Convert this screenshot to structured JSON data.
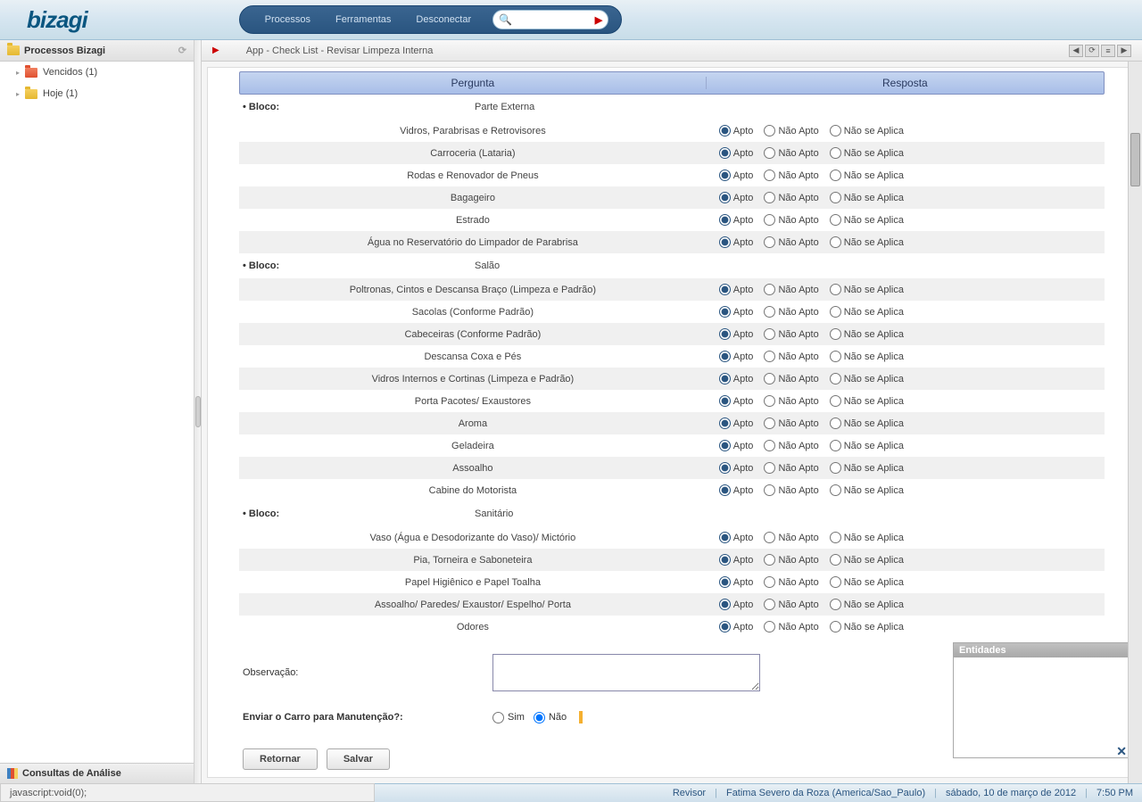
{
  "logo_text": "bizagi",
  "nav": {
    "processos": "Processos",
    "ferramentas": "Ferramentas",
    "desconectar": "Desconectar"
  },
  "sidebar": {
    "header": "Processos Bizagi",
    "items": [
      {
        "label": "Vencidos (1)",
        "icon": "red"
      },
      {
        "label": "Hoje (1)",
        "icon": "yellow"
      }
    ],
    "footer": "Consultas de Análise"
  },
  "breadcrumb": "App - Check List - Revisar Limpeza Interna",
  "table": {
    "header_pergunta": "Pergunta",
    "header_resposta": "Resposta",
    "opt_apto": "Apto",
    "opt_nao_apto": "Não Apto",
    "opt_na": "Não se Aplica",
    "bloco_label": "• Bloco:",
    "blocos": [
      {
        "titulo": "Parte Externa",
        "rows": [
          "Vidros, Parabrisas e Retrovisores",
          "Carroceria (Lataria)",
          "Rodas e Renovador de Pneus",
          "Bagageiro",
          "Estrado",
          "Água no Reservatório do Limpador de Parabrisa"
        ]
      },
      {
        "titulo": "Salão",
        "rows": [
          "Poltronas, Cintos e Descansa Braço (Limpeza e Padrão)",
          "Sacolas (Conforme Padrão)",
          "Cabeceiras (Conforme Padrão)",
          "Descansa Coxa e Pés",
          "Vidros Internos e Cortinas (Limpeza e Padrão)",
          "Porta Pacotes/ Exaustores",
          "Aroma",
          "Geladeira",
          "Assoalho",
          "Cabine do Motorista"
        ]
      },
      {
        "titulo": "Sanitário",
        "rows": [
          "Vaso (Água e Desodorizante do Vaso)/ Mictório",
          "Pia, Torneira e Saboneteira",
          "Papel Higiênico e Papel Toalha",
          "Assoalho/ Paredes/ Exaustor/ Espelho/ Porta",
          "Odores"
        ]
      }
    ]
  },
  "obs_label": "Observação:",
  "send_label": "Enviar o Carro para Manutenção?:",
  "send_sim": "Sim",
  "send_nao": "Não",
  "btn_retornar": "Retornar",
  "btn_salvar": "Salvar",
  "entidades": "Entidades",
  "status": {
    "js": "javascript:void(0);",
    "role": "Revisor",
    "user": "Fatima Severo da Roza (America/Sao_Paulo)",
    "date": "sábado, 10 de março de 2012",
    "time": "7:50 PM"
  }
}
